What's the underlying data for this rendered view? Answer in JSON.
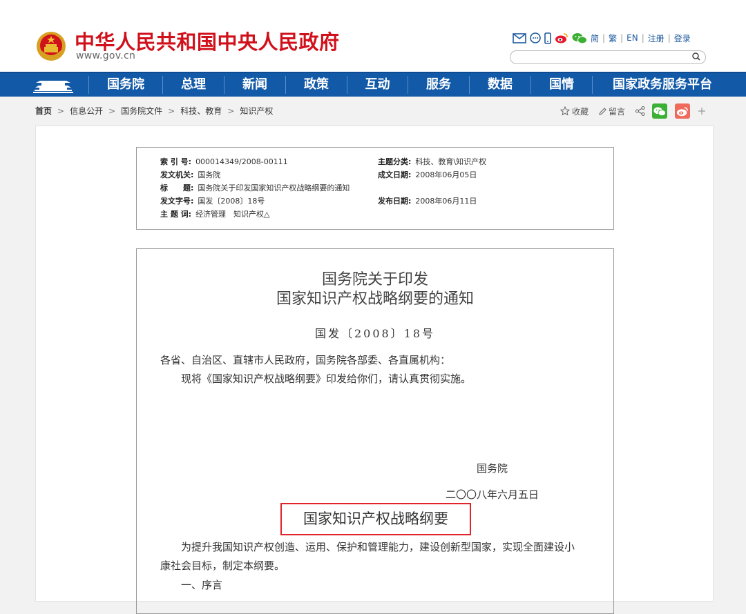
{
  "header": {
    "site_title": "中华人民共和国中央人民政府",
    "site_url": "www.gov.cn",
    "links": [
      "简",
      "繁",
      "EN",
      "注册",
      "登录"
    ],
    "icons": [
      "mail-icon",
      "chat-icon",
      "mobile-icon",
      "weibo-icon",
      "wechat-icon"
    ],
    "search_placeholder": ""
  },
  "nav": {
    "items": [
      "国务院",
      "总理",
      "新闻",
      "政策",
      "互动",
      "服务",
      "数据",
      "国情",
      "国家政务服务平台"
    ]
  },
  "breadcrumb": [
    "首页",
    "信息公开",
    "国务院文件",
    "科技、教育",
    "知识产权"
  ],
  "tools": {
    "favorite": "收藏",
    "comment": "留言"
  },
  "meta": {
    "index_no_label": "索 引 号:",
    "index_no": "000014349/2008-00111",
    "category_label": "主题分类:",
    "category": "科技、教育\\知识产权",
    "issuer_label": "发文机关:",
    "issuer": "国务院",
    "created_label": "成文日期:",
    "created": "2008年06月05日",
    "title_label": "标　　题:",
    "title": "国务院关于印发国家知识产权战略纲要的通知",
    "doc_no_label": "发文字号:",
    "doc_no": "国发〔2008〕18号",
    "published_label": "发布日期:",
    "published": "2008年06月11日",
    "keywords_label": "主 题 词:",
    "keywords": "经济管理　知识产权△"
  },
  "document": {
    "title_line1": "国务院关于印发",
    "title_line2": "国家知识产权战略纲要的通知",
    "doc_number": "国发〔2008〕18号",
    "salutation": "各省、自治区、直辖市人民政府，国务院各部委、各直属机构：",
    "body": "现将《国家知识产权战略纲要》印发给你们，请认真贯彻实施。",
    "signatory": "国务院",
    "date": "二〇〇八年六月五日",
    "section_title": "国家知识产权战略纲要",
    "intro_line1": "为提升我国知识产权创造、运用、保护和管理能力，建设创新型国家，实现全面建设小",
    "intro_line2": "康社会目标，制定本纲要。",
    "section_one": "一、序言"
  },
  "colors": {
    "brand_red": "#d0111b",
    "nav_blue": "#1259a7",
    "highlight_red": "#e0242a"
  }
}
